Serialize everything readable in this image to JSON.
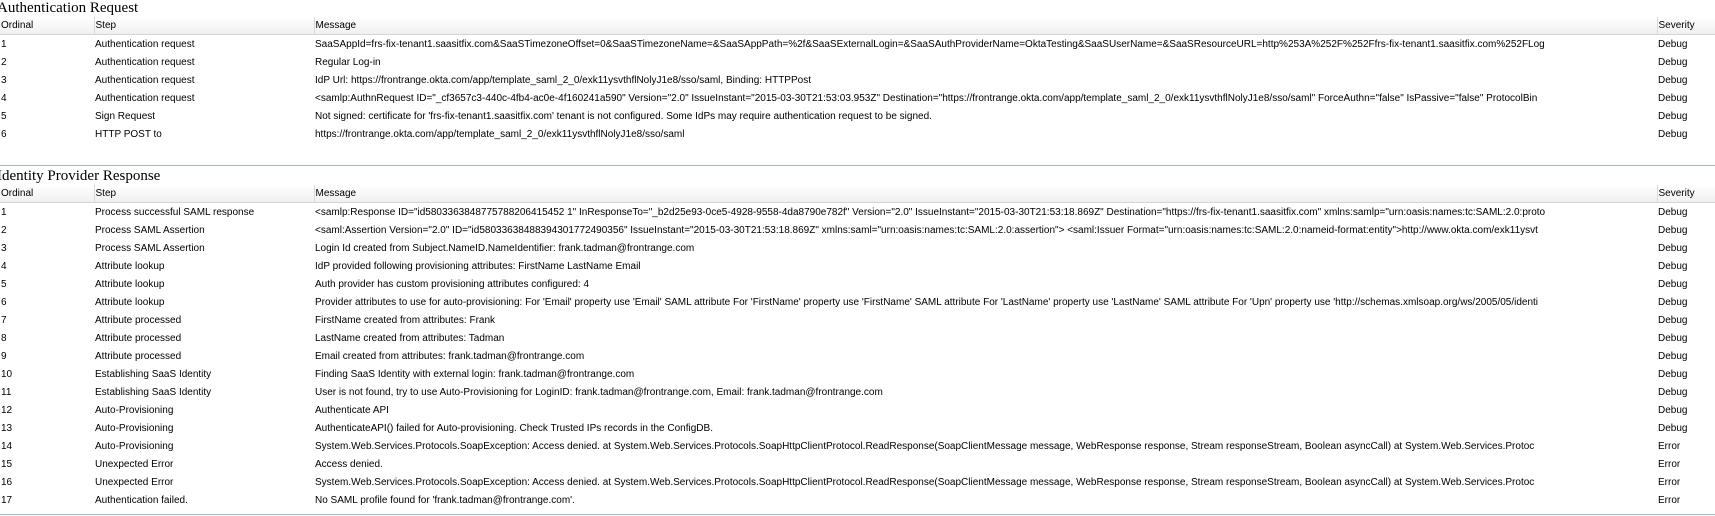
{
  "sections": [
    {
      "title": "Authentication Request",
      "columns": {
        "ordinal": "Ordinal",
        "step": "Step",
        "message": "Message",
        "severity": "Severity"
      },
      "rows": [
        [
          "1",
          "Authentication request",
          "SaaSAppId=frs-fix-tenant1.saasitfix.com&SaaSTimezoneOffset=0&SaaSTimezoneName=&SaaSAppPath=%2f&SaaSExternalLogin=&SaaSAuthProviderName=OktaTesting&SaaSUserName=&SaaSResourceURL=http%253A%252F%252Ffrs-fix-tenant1.saasitfix.com%252FLog",
          "Debug"
        ],
        [
          "2",
          "Authentication request",
          "Regular Log-in",
          "Debug"
        ],
        [
          "3",
          "Authentication request",
          "IdP Url: https://frontrange.okta.com/app/template_saml_2_0/exk11ysvthflNolyJ1e8/sso/saml, Binding: HTTPPost",
          "Debug"
        ],
        [
          "4",
          "Authentication request",
          "<samlp:AuthnRequest ID=\"_cf3657c3-440c-4fb4-ac0e-4f160241a590\" Version=\"2.0\" IssueInstant=\"2015-03-30T21:53:03.953Z\" Destination=\"https://frontrange.okta.com/app/template_saml_2_0/exk11ysvthflNolyJ1e8/sso/saml\" ForceAuthn=\"false\" IsPassive=\"false\" ProtocolBin",
          "Debug"
        ],
        [
          "5",
          "Sign Request",
          "Not signed: certificate for 'frs-fix-tenant1.saasitfix.com' tenant is not configured. Some IdPs may require authentication request to be signed.",
          "Debug"
        ],
        [
          "6",
          "HTTP POST to",
          "https://frontrange.okta.com/app/template_saml_2_0/exk11ysvthflNolyJ1e8/sso/saml",
          "Debug"
        ]
      ]
    },
    {
      "title": "Identity Provider Response",
      "columns": {
        "ordinal": "Ordinal",
        "step": "Step",
        "message": "Message",
        "severity": "Severity"
      },
      "rows": [
        [
          "1",
          "Process successful SAML response",
          "<samlp:Response ID=\"id5803363848775788206415452 1\" InResponseTo=\"_b2d25e93-0ce5-4928-9558-4da8790e782f\" Version=\"2.0\" IssueInstant=\"2015-03-30T21:53:18.869Z\" Destination=\"https://frs-fix-tenant1.saasitfix.com\" xmlns:samlp=\"urn:oasis:names:tc:SAML:2.0:proto",
          "Debug"
        ],
        [
          "2",
          "Process SAML Assertion",
          "<saml:Assertion Version=\"2.0\" ID=\"id58033638488394301772490356\" IssueInstant=\"2015-03-30T21:53:18.869Z\" xmlns:saml=\"urn:oasis:names:tc:SAML:2.0:assertion\"> <saml:Issuer Format=\"urn:oasis:names:tc:SAML:2.0:nameid-format:entity\">http://www.okta.com/exk11ysvt",
          "Debug"
        ],
        [
          "3",
          "Process SAML Assertion",
          "Login Id created from Subject.NameID.NameIdentifier: frank.tadman@frontrange.com",
          "Debug"
        ],
        [
          "4",
          "Attribute lookup",
          "IdP provided following provisioning attributes: FirstName LastName Email",
          "Debug"
        ],
        [
          "5",
          "Attribute lookup",
          "Auth provider has custom provisioning attributes configured: 4",
          "Debug"
        ],
        [
          "6",
          "Attribute lookup",
          "Provider attributes to use for auto-provisioning: For 'Email' property use 'Email' SAML attribute For 'FirstName' property use 'FirstName' SAML attribute For 'LastName' property use 'LastName' SAML attribute For 'Upn' property use 'http://schemas.xmlsoap.org/ws/2005/05/identi",
          "Debug"
        ],
        [
          "7",
          "Attribute processed",
          "FirstName created from attributes: Frank",
          "Debug"
        ],
        [
          "8",
          "Attribute processed",
          "LastName created from attributes: Tadman",
          "Debug"
        ],
        [
          "9",
          "Attribute processed",
          "Email created from attributes: frank.tadman@frontrange.com",
          "Debug"
        ],
        [
          "10",
          "Establishing SaaS Identity",
          "Finding SaaS Identity with external login: frank.tadman@frontrange.com",
          "Debug"
        ],
        [
          "11",
          "Establishing SaaS Identity",
          "User is not found, try to use Auto-Provisioning for LoginID: frank.tadman@frontrange.com, Email: frank.tadman@frontrange.com",
          "Debug"
        ],
        [
          "12",
          "Auto-Provisioning",
          "Authenticate API",
          "Debug"
        ],
        [
          "13",
          "Auto-Provisioning",
          "AuthenticateAPI() failed for Auto-provisioning. Check Trusted IPs records in the ConfigDB.",
          "Debug"
        ],
        [
          "14",
          "Auto-Provisioning",
          "System.Web.Services.Protocols.SoapException: Access denied. at System.Web.Services.Protocols.SoapHttpClientProtocol.ReadResponse(SoapClientMessage message, WebResponse response, Stream responseStream, Boolean asyncCall) at System.Web.Services.Protoc",
          "Error"
        ],
        [
          "15",
          "Unexpected Error",
          "Access denied.",
          "Error"
        ],
        [
          "16",
          "Unexpected Error",
          "System.Web.Services.Protocols.SoapException: Access denied. at System.Web.Services.Protocols.SoapHttpClientProtocol.ReadResponse(SoapClientMessage message, WebResponse response, Stream responseStream, Boolean asyncCall) at System.Web.Services.Protoc",
          "Error"
        ],
        [
          "17",
          "Authentication failed.",
          "No SAML profile found for 'frank.tadman@frontrange.com'.",
          "Error"
        ]
      ]
    }
  ]
}
